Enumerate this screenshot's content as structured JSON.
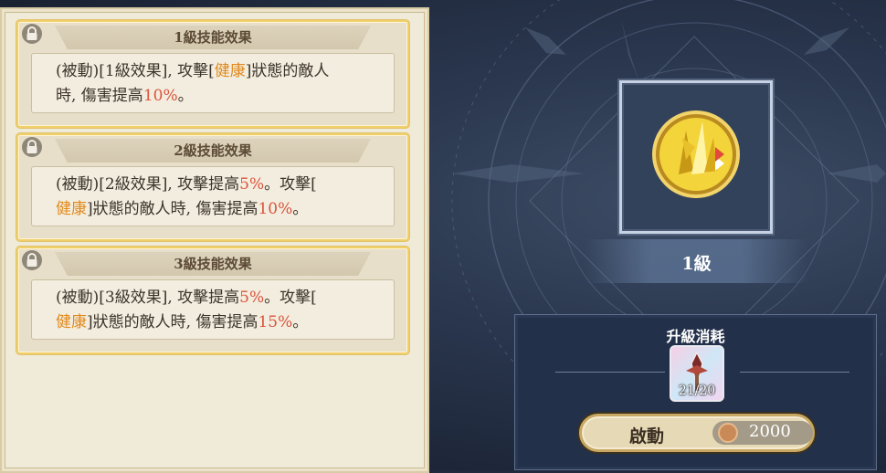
{
  "skill_cards": [
    {
      "title": "1級技能效果",
      "segments": [
        {
          "t": "(被動)[1級效果], 攻擊[",
          "c": ""
        },
        {
          "t": "健康",
          "c": "hl-or"
        },
        {
          "t": "]狀態的敵人",
          "c": ""
        },
        {
          "t": "時, 傷害提高",
          "c": "",
          "br": true
        },
        {
          "t": "10%",
          "c": "hl-red"
        },
        {
          "t": "。",
          "c": ""
        }
      ]
    },
    {
      "title": "2級技能效果",
      "segments": [
        {
          "t": "(被動)[2級效果], 攻擊提高",
          "c": ""
        },
        {
          "t": "5%",
          "c": "hl-red"
        },
        {
          "t": "。攻擊[",
          "c": ""
        },
        {
          "t": "健康",
          "c": "hl-or",
          "br": true
        },
        {
          "t": "]狀態的敵人時, 傷害提高",
          "c": ""
        },
        {
          "t": "10%",
          "c": "hl-red"
        },
        {
          "t": "。",
          "c": ""
        }
      ]
    },
    {
      "title": "3級技能效果",
      "segments": [
        {
          "t": "(被動)[3級效果], 攻擊提高",
          "c": ""
        },
        {
          "t": "5%",
          "c": "hl-red"
        },
        {
          "t": "。攻擊[",
          "c": ""
        },
        {
          "t": "健康",
          "c": "hl-or",
          "br": true
        },
        {
          "t": "]狀態的敵人時, 傷害提高",
          "c": ""
        },
        {
          "t": "15%",
          "c": "hl-red"
        },
        {
          "t": "。",
          "c": ""
        }
      ]
    }
  ],
  "skill": {
    "level_label": "1級",
    "icon": "golden-crystal-skill-icon"
  },
  "upgrade": {
    "title": "升級消耗",
    "item_count": "21/20",
    "item_icon": "sword-shard-icon",
    "button_label": "啟動",
    "price": "2000",
    "currency_icon": "coin-icon"
  },
  "colors": {
    "highlight_status": "#e08a1e",
    "highlight_value": "#d9543c",
    "card_border": "#f0cf6b"
  }
}
